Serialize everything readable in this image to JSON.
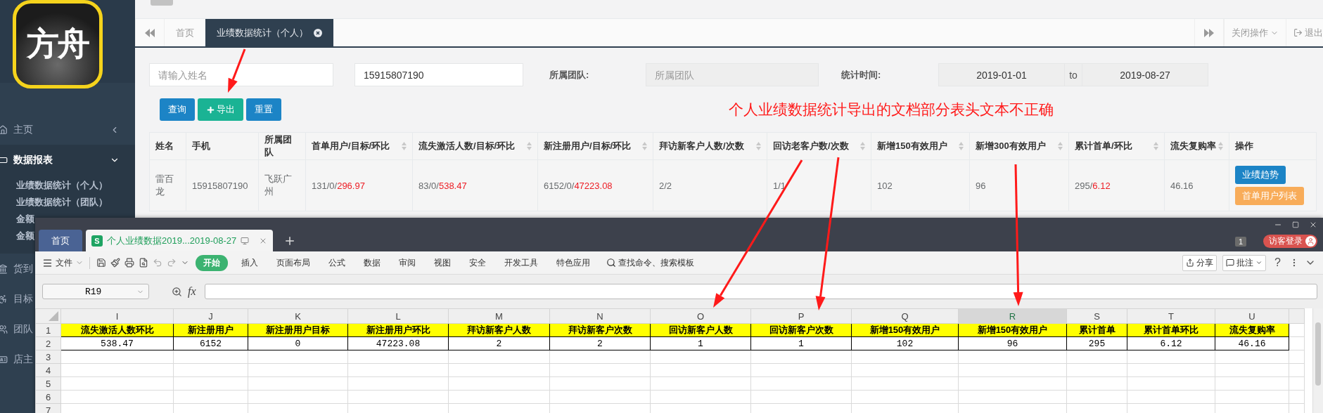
{
  "sidebar": {
    "logo_text": "方舟",
    "items": [
      {
        "label": "主页",
        "expanded": false
      },
      {
        "label": "数据报表",
        "expanded": true,
        "children": [
          {
            "label": "业绩数据统计（个人）"
          },
          {
            "label": "业绩数据统计（团队）"
          },
          {
            "label": "金额"
          },
          {
            "label": "金额"
          }
        ]
      },
      {
        "label": "货到"
      },
      {
        "label": "目标"
      },
      {
        "label": "团队"
      },
      {
        "label": "店主"
      }
    ]
  },
  "page_tabs": [
    {
      "label": "首页",
      "selected": false
    },
    {
      "label": "业绩数据统计（个人）",
      "selected": true
    }
  ],
  "tab_menu": {
    "close_ops": "关闭操作",
    "logout": "退出"
  },
  "filters": {
    "name_field": {
      "placeholder": "请输入姓名"
    },
    "phone_field": {
      "value": "15915807190"
    },
    "team": {
      "label": "所属团队:",
      "placeholder": "所属团队"
    },
    "date_range": {
      "label": "统计时间:",
      "from": "2019-01-01",
      "separator": "to",
      "to": "2019-08-27"
    }
  },
  "buttons": [
    {
      "label": "查询",
      "kind": "primary"
    },
    {
      "label": "导出",
      "kind": "export"
    },
    {
      "label": "重置",
      "kind": "primary"
    }
  ],
  "annotation": "个人业绩数据统计导出的文档部分表头文本不正确",
  "table": {
    "columns": [
      {
        "label": "姓名",
        "sortable": false
      },
      {
        "label": "手机",
        "sortable": false
      },
      {
        "label": "所属团队",
        "sortable": false
      },
      {
        "label": "首单用户/目标/环比",
        "sortable": true
      },
      {
        "label": "流失激活人数/目标/环比",
        "sortable": true
      },
      {
        "label": "新注册用户/目标/环比",
        "sortable": true
      },
      {
        "label": "拜访新客户人数/次数",
        "sortable": true
      },
      {
        "label": "回访老客户数/次数",
        "sortable": true
      },
      {
        "label": "新增150有效用户",
        "sortable": true
      },
      {
        "label": "新增300有效用户",
        "sortable": true
      },
      {
        "label": "累计首单/环比",
        "sortable": true
      },
      {
        "label": "流失复购率",
        "sortable": true
      },
      {
        "label": "操作",
        "sortable": false
      }
    ],
    "rows": [
      {
        "cells": [
          {
            "text": "雷百龙"
          },
          {
            "text": "15915807190"
          },
          {
            "text": "飞跃广州"
          },
          {
            "text": "131/0/",
            "red": "296.97"
          },
          {
            "text": "83/0/",
            "red": "538.47"
          },
          {
            "text": "6152/0/",
            "red": "47223.08"
          },
          {
            "text": "2/2"
          },
          {
            "text": "1/1"
          },
          {
            "text": "102"
          },
          {
            "text": "96"
          },
          {
            "text": "295/",
            "red": "6.12"
          },
          {
            "text": "46.16"
          }
        ],
        "actions": [
          {
            "label": "业绩趋势",
            "kind": "primary"
          },
          {
            "label": "首单用户列表",
            "kind": "warning"
          }
        ]
      }
    ]
  },
  "spreadsheet": {
    "tabs": [
      {
        "label": "首页",
        "selected": false
      },
      {
        "label": "个人业绩数据2019...2019-08-27",
        "selected": true,
        "app_letter": "S"
      }
    ],
    "page_count": "1",
    "login": "访客登录",
    "file_menu": "文件",
    "ribbon": [
      {
        "label": "开始",
        "selected": true
      },
      {
        "label": "插入",
        "selected": false
      },
      {
        "label": "页面布局",
        "selected": false
      },
      {
        "label": "公式",
        "selected": false
      },
      {
        "label": "数据",
        "selected": false
      },
      {
        "label": "审阅",
        "selected": false
      },
      {
        "label": "视图",
        "selected": false
      },
      {
        "label": "安全",
        "selected": false
      },
      {
        "label": "开发工具",
        "selected": false
      },
      {
        "label": "特色应用",
        "selected": false
      }
    ],
    "command_search": "查找命令、搜索模板",
    "share": "分享",
    "comment": "批注",
    "help": "?",
    "name_box": "R19",
    "fx": "fx",
    "columns": [
      {
        "letter": "I",
        "selected": false
      },
      {
        "letter": "J",
        "selected": false
      },
      {
        "letter": "K",
        "selected": false
      },
      {
        "letter": "L",
        "selected": false
      },
      {
        "letter": "M",
        "selected": false
      },
      {
        "letter": "N",
        "selected": false
      },
      {
        "letter": "O",
        "selected": false
      },
      {
        "letter": "P",
        "selected": false
      },
      {
        "letter": "Q",
        "selected": false
      },
      {
        "letter": "R",
        "selected": true
      },
      {
        "letter": "S",
        "selected": false
      },
      {
        "letter": "T",
        "selected": false
      },
      {
        "letter": "U",
        "selected": false
      }
    ],
    "rows": [
      {
        "number": "1",
        "kind": "header",
        "cells": [
          "流失激活人数环比",
          "新注册用户",
          "新注册用户目标",
          "新注册用户环比",
          "拜访新客户人数",
          "拜访新客户次数",
          "回访新客户人数",
          "回访新客户次数",
          "新增150有效用户",
          "新增150有效用户",
          "累计首单",
          "累计首单环比",
          "流失复购率"
        ]
      },
      {
        "number": "2",
        "kind": "data",
        "cells": [
          "538.47",
          "6152",
          "0",
          "47223.08",
          "2",
          "2",
          "1",
          "1",
          "102",
          "96",
          "295",
          "6.12",
          "46.16"
        ]
      },
      {
        "number": "3",
        "kind": "blank"
      },
      {
        "number": "4",
        "kind": "blank"
      },
      {
        "number": "5",
        "kind": "blank"
      },
      {
        "number": "6",
        "kind": "blank"
      },
      {
        "number": "7",
        "kind": "blank"
      }
    ]
  }
}
